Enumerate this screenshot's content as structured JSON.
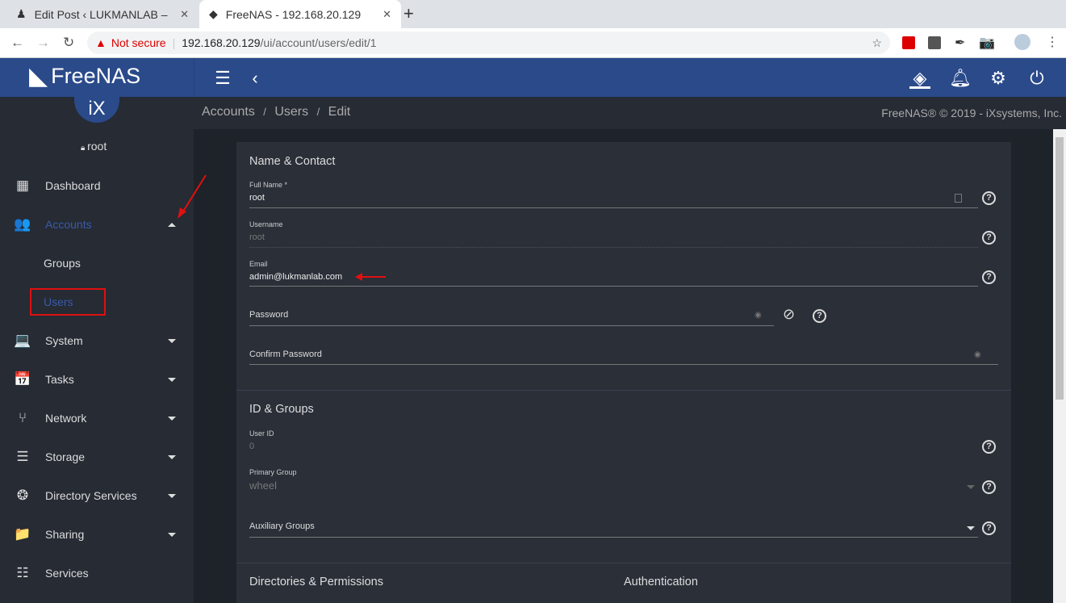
{
  "browser": {
    "tabs": [
      {
        "title": "Edit Post ‹ LUKMANLAB –",
        "active": false
      },
      {
        "title": "FreeNAS - 192.168.20.129",
        "active": true
      }
    ],
    "security": "Not secure",
    "url_host": "192.168.20.129",
    "url_path": "/ui/account/users/edit/1"
  },
  "header": {
    "brand": "FreeNAS",
    "logo_sub": "iX"
  },
  "user": "root",
  "sidebar": {
    "items": [
      {
        "label": "Dashboard",
        "icon": "dashboard-icon",
        "glyph": "▦"
      },
      {
        "label": "Accounts",
        "icon": "people-icon",
        "glyph": "👥",
        "expanded": true
      },
      {
        "label": "Groups"
      },
      {
        "label": "Users",
        "active": true
      },
      {
        "label": "System",
        "icon": "laptop-icon",
        "glyph": "💻"
      },
      {
        "label": "Tasks",
        "icon": "calendar-icon",
        "glyph": "📅"
      },
      {
        "label": "Network",
        "icon": "network-icon",
        "glyph": "⑂"
      },
      {
        "label": "Storage",
        "icon": "storage-icon",
        "glyph": "☰"
      },
      {
        "label": "Directory Services",
        "icon": "directory-icon",
        "glyph": "❂"
      },
      {
        "label": "Sharing",
        "icon": "folder-shared-icon",
        "glyph": "📁"
      },
      {
        "label": "Services",
        "icon": "tune-icon",
        "glyph": "☷"
      }
    ]
  },
  "breadcrumb": [
    "Accounts",
    "Users",
    "Edit"
  ],
  "copyright": "FreeNAS® © 2019 - iXsystems, Inc.",
  "form": {
    "section1": "Name & Contact",
    "full_name": {
      "label": "Full Name *",
      "value": "root"
    },
    "username": {
      "label": "Username",
      "value": "root"
    },
    "email": {
      "label": "Email",
      "value": "admin@lukmanlab.com"
    },
    "password": {
      "label": "Password"
    },
    "confirm": {
      "label": "Confirm Password"
    },
    "section2": "ID & Groups",
    "uid": {
      "label": "User ID",
      "value": "0"
    },
    "primary_group": {
      "label": "Primary Group",
      "value": "wheel"
    },
    "aux_groups": {
      "label": "Auxiliary Groups"
    },
    "section3": "Directories & Permissions",
    "section4": "Authentication"
  },
  "colors": {
    "header": "#2a4a8a",
    "sidebar": "#262b34",
    "card": "#2a2f38",
    "accent": "#3a5ba8",
    "annotation": "#e01010"
  }
}
